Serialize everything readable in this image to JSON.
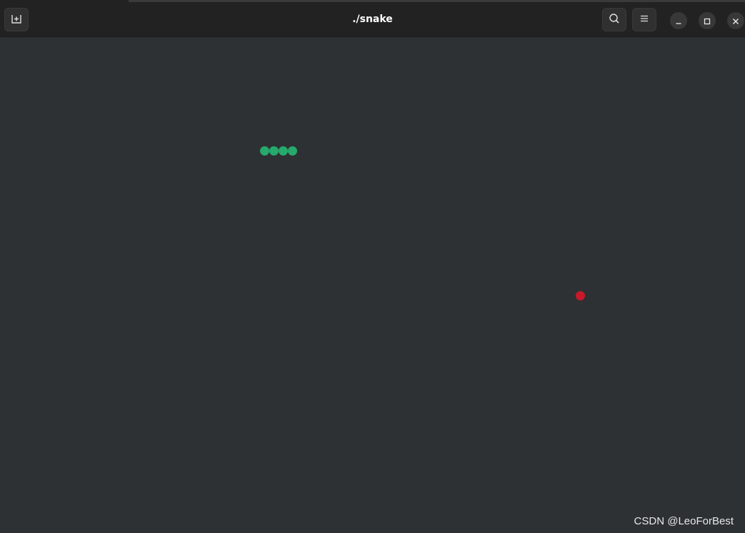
{
  "window": {
    "title": "./snake"
  },
  "header": {
    "new_tab_icon": "new-tab-icon",
    "search_icon": "search-icon",
    "menu_icon": "hamburger-menu-icon",
    "minimize_icon": "minimize-icon",
    "maximize_icon": "maximize-icon",
    "close_icon": "close-icon"
  },
  "game": {
    "snake_color": "#26a96c",
    "food_color": "#c8192a",
    "background_color": "#2d3134"
  },
  "watermark": "CSDN @LeoForBest"
}
